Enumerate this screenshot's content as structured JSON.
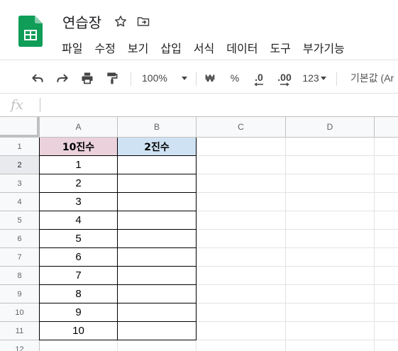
{
  "app": {
    "doc_title": "연습장",
    "icons": {
      "star": "star-icon",
      "move": "move-to-folder-icon",
      "logo": "sheets-logo"
    }
  },
  "menu": [
    "파일",
    "수정",
    "보기",
    "삽입",
    "서식",
    "데이터",
    "도구",
    "부가기능"
  ],
  "toolbar": {
    "zoom": "100%",
    "currency": "₩",
    "percent": "%",
    "decrease_decimal": ".0",
    "increase_decimal": ".00",
    "more_formats": "123",
    "font": "기본값 (Ar"
  },
  "formula_bar": {
    "fx_label": "fx",
    "value": ""
  },
  "sheet": {
    "columns": [
      "A",
      "B",
      "C",
      "D"
    ],
    "rows": [
      "1",
      "2",
      "3",
      "4",
      "5",
      "6",
      "7",
      "8",
      "9",
      "10",
      "11",
      "12"
    ],
    "header_a": "10진수",
    "header_b": "2진수",
    "values_a": [
      "1",
      "2",
      "3",
      "4",
      "5",
      "6",
      "7",
      "8",
      "9",
      "10"
    ]
  },
  "colors": {
    "header_a_fill": "#ead1dc",
    "header_b_fill": "#cfe2f3",
    "logo_green": "#0f9d58"
  }
}
